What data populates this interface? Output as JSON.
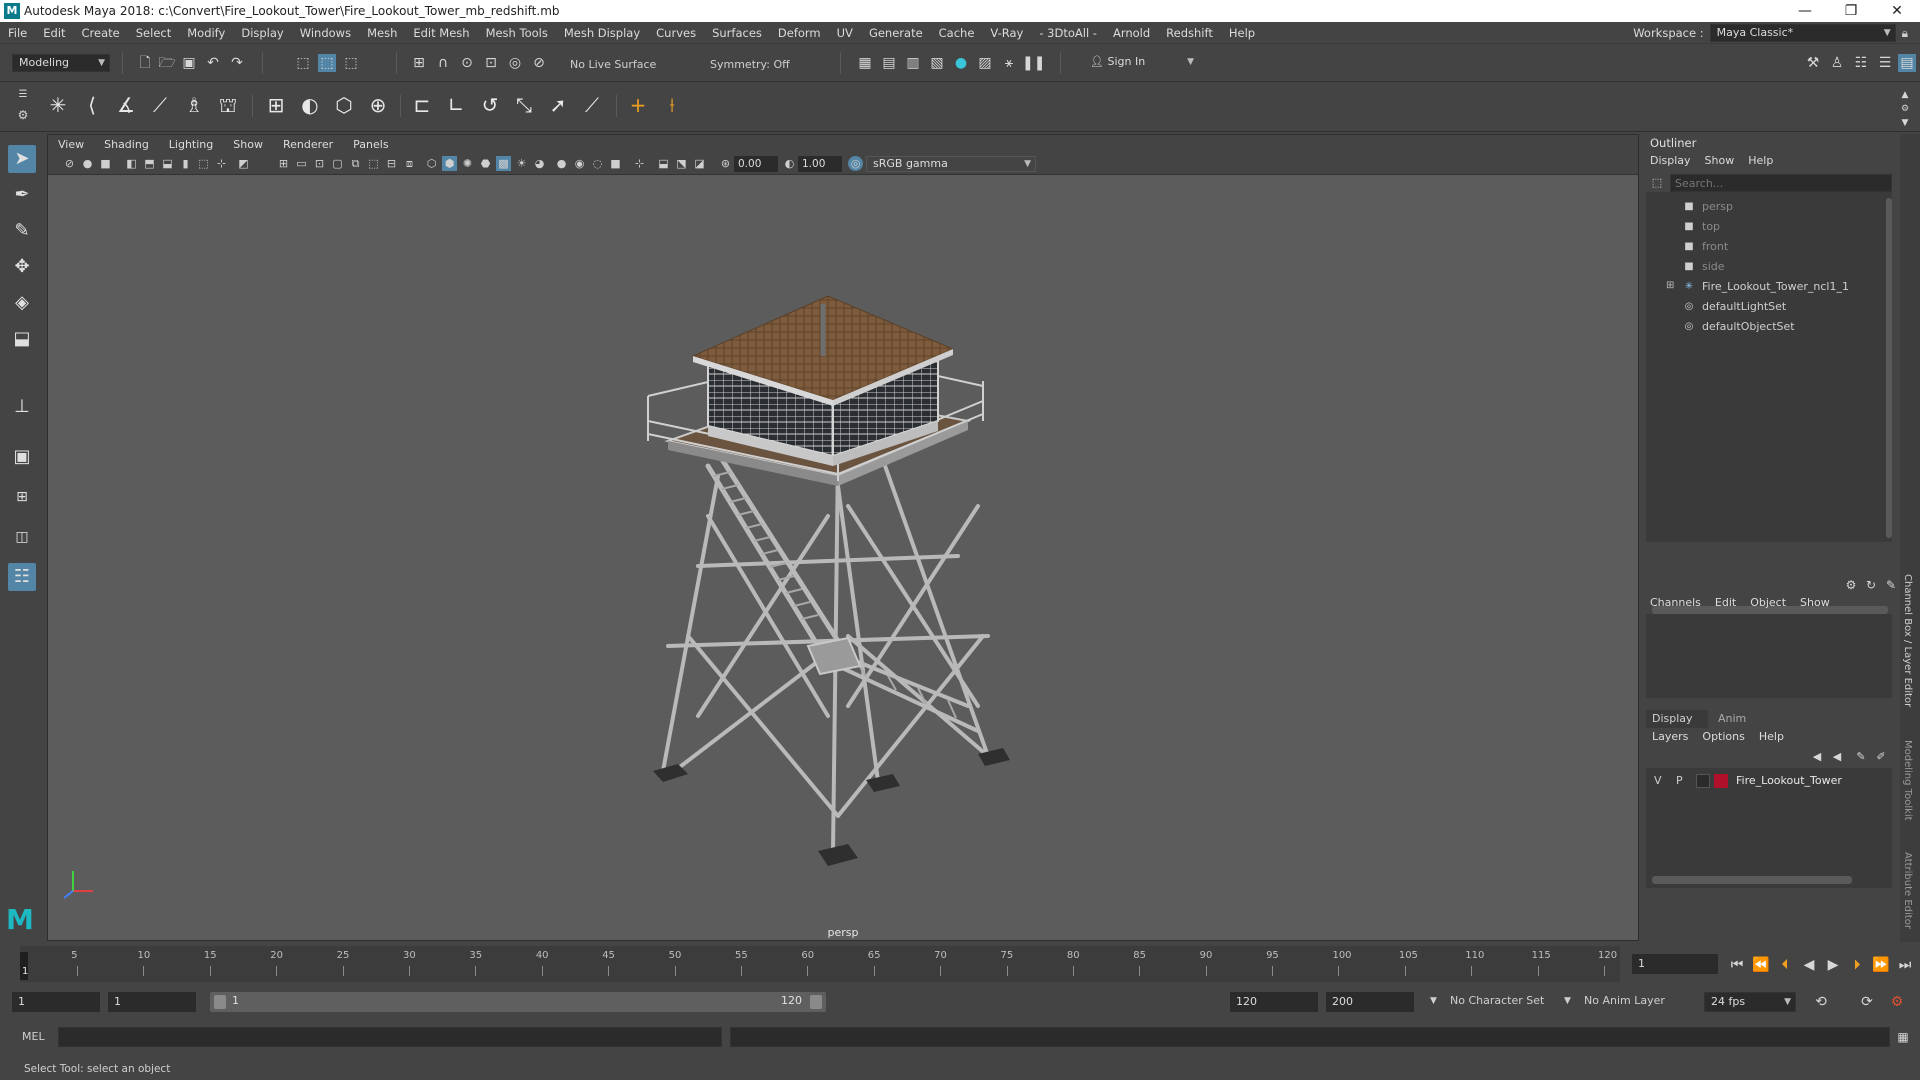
{
  "titlebar": {
    "title": "Autodesk Maya 2018: c:\\Convert\\Fire_Lookout_Tower\\Fire_Lookout_Tower_mb_redshift.mb",
    "logo": "M",
    "minimize": "—",
    "maximize": "❐",
    "close": "✕"
  },
  "menubar": {
    "items": [
      "File",
      "Edit",
      "Create",
      "Select",
      "Modify",
      "Display",
      "Windows",
      "Mesh",
      "Edit Mesh",
      "Mesh Tools",
      "Mesh Display",
      "Curves",
      "Surfaces",
      "Deform",
      "UV",
      "Generate",
      "Cache",
      "V-Ray",
      "- 3DtoAll -",
      "Arnold",
      "Redshift",
      "Help"
    ],
    "workspace_label": "Workspace :",
    "workspace_value": "Maya Classic*"
  },
  "statusline": {
    "mode": "Modeling",
    "live_surface": "No Live Surface",
    "symmetry": "Symmetry: Off",
    "sign_in": "Sign In"
  },
  "viewport": {
    "menu": [
      "View",
      "Shading",
      "Lighting",
      "Show",
      "Renderer",
      "Panels"
    ],
    "exposure": "0.00",
    "gamma": "1.00",
    "colorspace": "sRGB gamma",
    "camera_label": "persp"
  },
  "outliner": {
    "title": "Outliner",
    "menu": [
      "Display",
      "Show",
      "Help"
    ],
    "search_placeholder": "Search...",
    "items": [
      {
        "label": "persp",
        "icon": "camera-icon",
        "dim": true
      },
      {
        "label": "top",
        "icon": "camera-icon",
        "dim": true
      },
      {
        "label": "front",
        "icon": "camera-icon",
        "dim": true
      },
      {
        "label": "side",
        "icon": "camera-icon",
        "dim": true
      },
      {
        "label": "Fire_Lookout_Tower_ncl1_1",
        "icon": "group-icon",
        "dim": false
      },
      {
        "label": "defaultLightSet",
        "icon": "set-icon",
        "dim": false
      },
      {
        "label": "defaultObjectSet",
        "icon": "set-icon",
        "dim": false
      }
    ]
  },
  "channelbox": {
    "menu": [
      "Channels",
      "Edit",
      "Object",
      "Show"
    ]
  },
  "layereditor": {
    "tabs": [
      "Display",
      "Anim"
    ],
    "menu": [
      "Layers",
      "Options",
      "Help"
    ],
    "layer": {
      "v": "V",
      "p": "P",
      "name": "Fire_Lookout_Tower",
      "color": "#b0102a"
    }
  },
  "sidetabs": [
    "Channel Box / Layer Editor",
    "Modeling Toolkit",
    "Attribute Editor"
  ],
  "timeline": {
    "ticks": [
      1,
      5,
      10,
      15,
      20,
      25,
      30,
      35,
      40,
      45,
      50,
      55,
      60,
      65,
      70,
      75,
      80,
      85,
      90,
      95,
      100,
      105,
      110,
      115,
      120
    ],
    "current_frame": "1",
    "current_field": "1"
  },
  "range": {
    "start": "1",
    "playback_start": "1",
    "slider_start": "1",
    "slider_end": "120",
    "playback_end": "120",
    "end": "200",
    "character_set": "No Character Set",
    "anim_layer": "No Anim Layer",
    "fps": "24 fps"
  },
  "commandline": {
    "label": "MEL"
  },
  "helpline": {
    "text": "Select Tool: select an object"
  },
  "colors": {
    "accent": "#5285a6",
    "panel_bg": "#444444",
    "viewport_bg": "#5c5c5c",
    "field_bg": "#2b2b2b",
    "roof": "#7a5a3a",
    "tower": "#b8b8b8"
  }
}
